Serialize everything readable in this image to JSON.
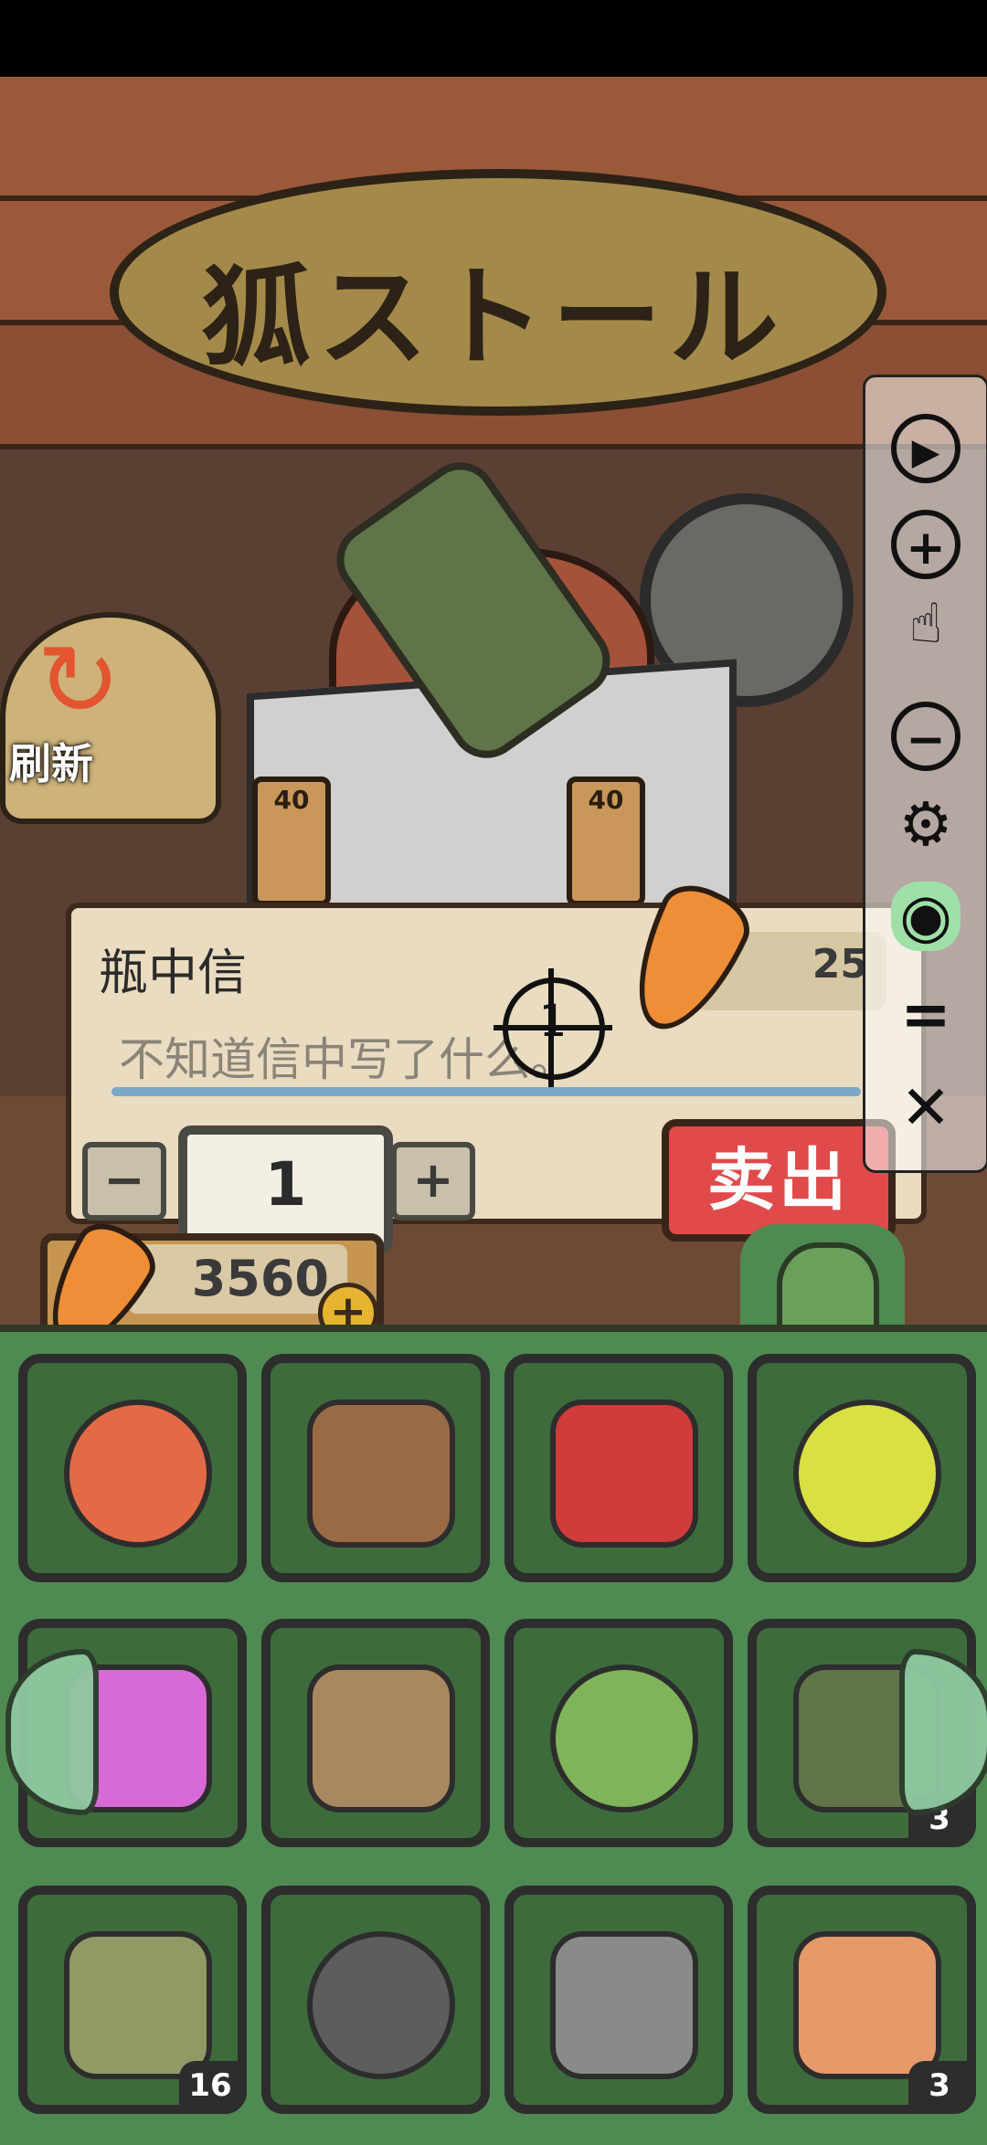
{
  "shop": {
    "sign_title": "狐ストール",
    "refresh_label": "刷新",
    "tags": [
      "40",
      "40"
    ]
  },
  "item_detail": {
    "name": "瓶中信",
    "price": "25",
    "description": "不知道信中写了什么。",
    "quantity": "1",
    "decrement_label": "−",
    "increment_label": "+",
    "sell_label": "卖出",
    "cursor_number": "1"
  },
  "wallet": {
    "carrots": "3560",
    "add_label": "+"
  },
  "inventory": {
    "slots": [
      {
        "name": "guitar",
        "count": "",
        "color": "#e46a45"
      },
      {
        "name": "paddle",
        "count": "",
        "color": "#9a6a45"
      },
      {
        "name": "kite",
        "count": "",
        "color": "#d03b3b"
      },
      {
        "name": "swim-ring",
        "count": "",
        "color": "#d8e042"
      },
      {
        "name": "potion",
        "count": "",
        "color": "#d86ad8"
      },
      {
        "name": "rope-net",
        "count": "",
        "color": "#a98861"
      },
      {
        "name": "book-lord-of-the-carrots",
        "count": "",
        "color": "#7fb45a"
      },
      {
        "name": "message-bottle",
        "count": "3",
        "color": "#5f7448"
      },
      {
        "name": "bass-fish",
        "count": "16",
        "color": "#8f9a65"
      },
      {
        "name": "catfish",
        "count": "",
        "color": "#5d5d5d"
      },
      {
        "name": "sturgeon",
        "count": "",
        "color": "#8a8a8a"
      },
      {
        "name": "collection-ticket",
        "count": "3",
        "color": "#e69a6a"
      }
    ]
  },
  "toolbar": {
    "play": "▶",
    "zoom_in": "+",
    "zoom_out": "−",
    "settings": "⚙",
    "menu": "=",
    "close": "✕"
  }
}
